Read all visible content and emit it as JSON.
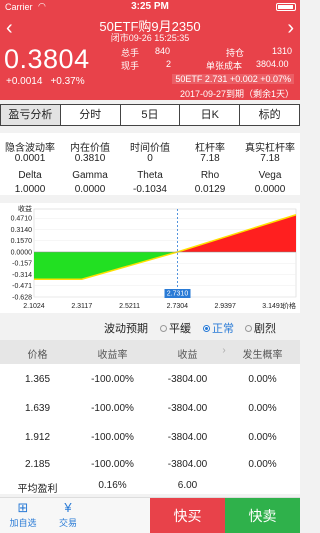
{
  "status": {
    "carrier": "Carrier",
    "time": "3:25 PM"
  },
  "header": {
    "title": "50ETF购9月2350",
    "subtitle": "闭市09-26 15:25:35",
    "price": "0.3804",
    "change": "+0.0014",
    "change_pct": "+0.37%",
    "stats": {
      "zongshou_label": "总手",
      "zongshou_value": "840",
      "xianshou_label": "现手",
      "xianshou_value": "2",
      "chicang_label": "持仓",
      "chicang_value": "1310",
      "danzhang_label": "单张成本",
      "danzhang_value": "3804.00"
    },
    "underlying": "50ETF 2.731 +0.002 +0.07%",
    "expiry": "2017-09-27到期（剩余1天）"
  },
  "tabs": [
    {
      "label": "盈亏分析"
    },
    {
      "label": "分时"
    },
    {
      "label": "5日"
    },
    {
      "label": "日K"
    },
    {
      "label": "标的"
    }
  ],
  "greeks": [
    {
      "label": "隐含波动率",
      "value": "0.0001"
    },
    {
      "label": "内在价值",
      "value": "0.3810"
    },
    {
      "label": "时间价值",
      "value": "0"
    },
    {
      "label": "杠杆率",
      "value": "7.18"
    },
    {
      "label": "真实杠杆率",
      "value": "7.18"
    },
    {
      "label": "Delta",
      "value": "1.0000"
    },
    {
      "label": "Gamma",
      "value": "0.0000"
    },
    {
      "label": "Theta",
      "value": "-0.1034"
    },
    {
      "label": "Rho",
      "value": "0.0129"
    },
    {
      "label": "Vega",
      "value": "0.0000"
    }
  ],
  "chart_data": {
    "type": "area",
    "ylabel": "收益",
    "xlabel": "价格",
    "y_ticks": [
      "0.4710",
      "0.3140",
      "0.1570",
      "0.0000",
      "-0.157",
      "-0.314",
      "-0.471",
      "-0.628"
    ],
    "x_ticks": [
      "2.1024",
      "2.3117",
      "2.5211",
      "2.7304",
      "2.9397",
      "3.1491"
    ],
    "cursor_label": "2.7310",
    "x": [
      2.1024,
      2.3117,
      2.7304,
      3.25
    ],
    "y": [
      -0.3804,
      -0.3804,
      0.0,
      0.52
    ],
    "xlim": [
      2.1024,
      3.25
    ],
    "ylim": [
      -0.628,
      0.6
    ],
    "colors": {
      "loss": "#22e022",
      "profit": "#ff1f1f",
      "line": "#ffe100",
      "cursor": "#2a7bd6"
    }
  },
  "volatility": {
    "label": "波动预期",
    "options": [
      {
        "label": "平缓",
        "selected": false
      },
      {
        "label": "正常",
        "selected": true
      },
      {
        "label": "剧烈",
        "selected": false
      }
    ]
  },
  "table": {
    "headers": [
      "价格",
      "收益率",
      "收益",
      "发生概率"
    ],
    "rows": [
      {
        "price": "1.365",
        "rate": "-100.00%",
        "profit": "-3804.00",
        "prob": "0.00%"
      },
      {
        "price": "1.639",
        "rate": "-100.00%",
        "profit": "-3804.00",
        "prob": "0.00%"
      },
      {
        "price": "1.912",
        "rate": "-100.00%",
        "profit": "-3804.00",
        "prob": "0.00%"
      },
      {
        "price": "2.185",
        "rate": "-100.00%",
        "profit": "-3804.00",
        "prob": "0.00%"
      }
    ],
    "avg": {
      "label": "平均盈利",
      "rate": "0.16%",
      "profit": "6.00"
    }
  },
  "bottom": {
    "add_label": "加自选",
    "trade_label": "交易",
    "buy_label": "快买",
    "sell_label": "快卖"
  },
  "colors": {
    "brand_red": "#e8424a",
    "sell_green": "#2fb14b",
    "accent_blue": "#2a7bd6"
  }
}
